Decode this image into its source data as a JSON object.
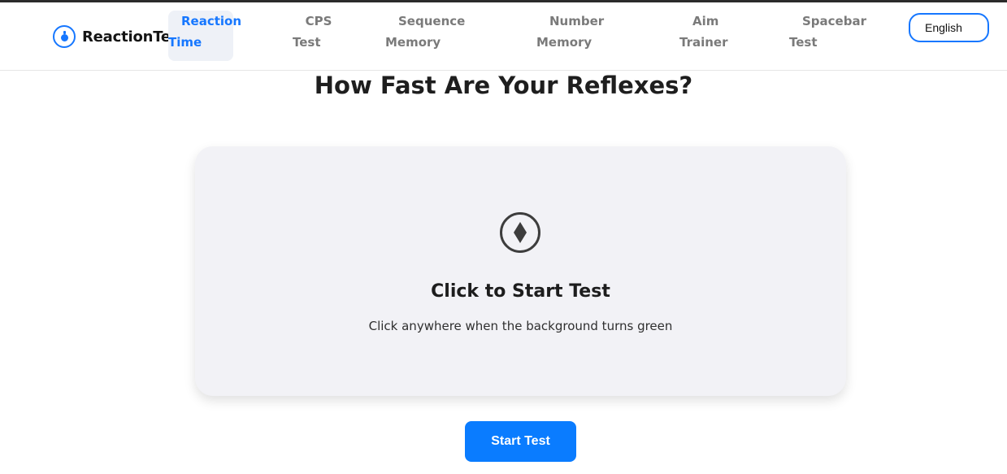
{
  "brand": {
    "name": "ReactionTest",
    "icon": "stopwatch-icon",
    "accent": "#1677ff"
  },
  "nav": {
    "items": [
      {
        "line1": "Reaction",
        "line2": "Time",
        "active": true
      },
      {
        "line1": "CPS",
        "line2": "Test",
        "active": false
      },
      {
        "line1": "Sequence",
        "line2": "Memory",
        "active": false
      },
      {
        "line1": "Number",
        "line2": "Memory",
        "active": false
      },
      {
        "line1": "Aim",
        "line2": "Trainer",
        "active": false
      },
      {
        "line1": "Spacebar",
        "line2": "Test",
        "active": false
      }
    ]
  },
  "language": {
    "selected": "English"
  },
  "main": {
    "title": "How Fast Are Your Reflexes?",
    "card": {
      "icon": "target-diamond-icon",
      "title": "Click to Start Test",
      "subtitle": "Click anywhere when the background turns green"
    },
    "start_button": "Start Test",
    "button_color": "#0a7cff"
  }
}
